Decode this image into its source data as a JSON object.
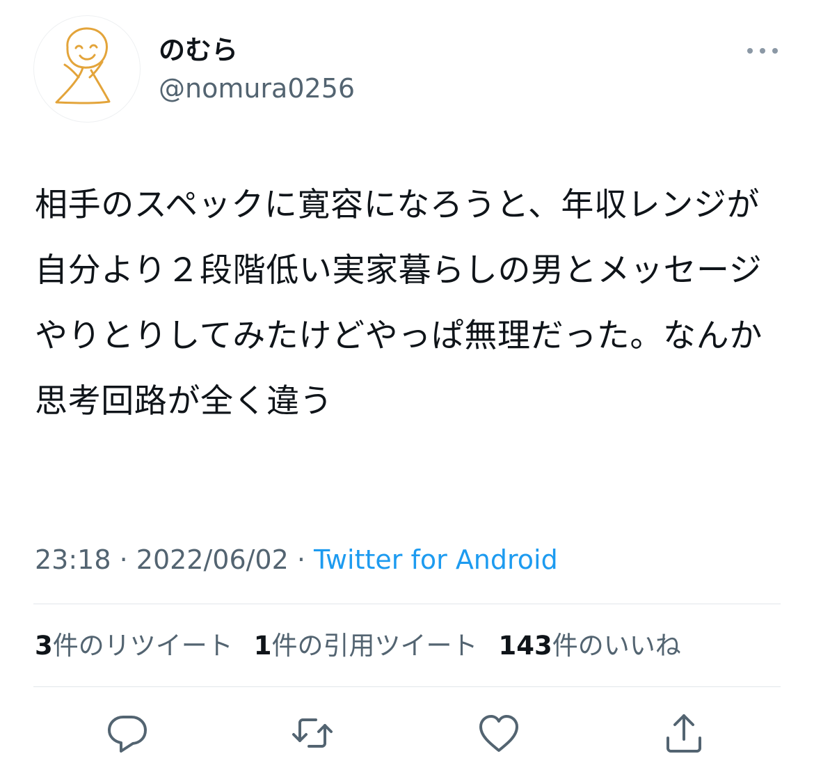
{
  "author": {
    "display_name": "のむら",
    "handle": "@nomura0256",
    "avatar_icon": "hand-drawn-smiley-avatar"
  },
  "tweet": {
    "text": "相手のスペックに寛容になろうと、年収レンジが自分より２段階低い実家暮らしの男とメッセージやりとりしてみたけどやっぱ無理だった。なんか思考回路が全く違う"
  },
  "meta": {
    "time": "23:18",
    "separator": " · ",
    "date": "2022/06/02",
    "source": "Twitter for Android"
  },
  "stats": {
    "retweets": {
      "count": "3",
      "label": "件のリツイート"
    },
    "quotes": {
      "count": "1",
      "label": "件の引用ツイート"
    },
    "likes": {
      "count": "143",
      "label": "件のいいね"
    }
  },
  "actions": {
    "icons": [
      "reply-icon",
      "retweet-icon",
      "like-icon",
      "share-icon"
    ]
  },
  "colors": {
    "text_primary": "#0f1419",
    "text_secondary": "#536471",
    "link": "#1d9bf0",
    "avatar_stroke": "#e3a43a",
    "divider": "#e1e6ea"
  }
}
